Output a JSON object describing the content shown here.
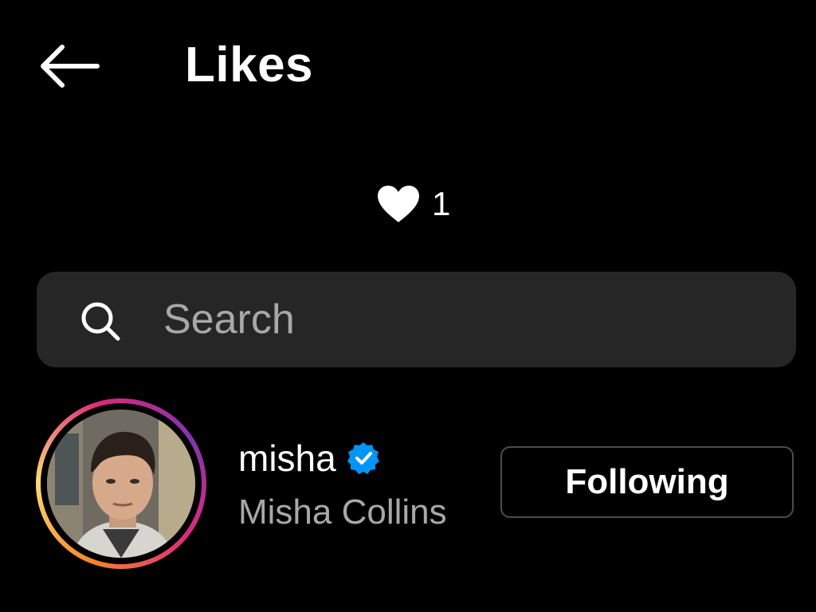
{
  "header": {
    "back_icon": "arrow-left-icon",
    "title": "Likes"
  },
  "likes": {
    "icon": "heart-filled-icon",
    "count": "1"
  },
  "search": {
    "icon": "search-icon",
    "placeholder": "Search",
    "value": ""
  },
  "likers": [
    {
      "username": "misha",
      "verified": true,
      "verified_color": "#0095f6",
      "full_name": "Misha Collins",
      "button_label": "Following"
    }
  ],
  "colors": {
    "background": "#000000",
    "search_bg": "#262626",
    "secondary_text": "#a8a8a8",
    "button_border": "#4d4d4d"
  }
}
